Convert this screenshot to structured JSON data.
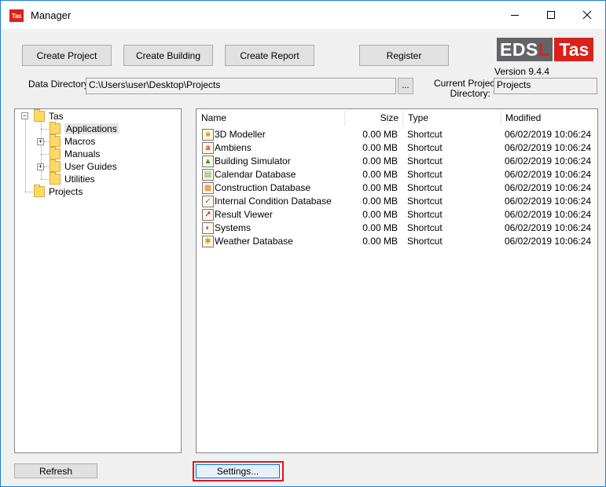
{
  "window": {
    "title": "Manager",
    "icon_text": "Tas",
    "controls": {
      "minimize": "minimize-icon",
      "maximize": "maximize-icon",
      "close": "close-icon"
    }
  },
  "toolbar": {
    "create_project": "Create Project",
    "create_building": "Create Building",
    "create_report": "Create Report",
    "register": "Register"
  },
  "logo": {
    "part1": "EDS",
    "part2": "L",
    "part3": "Tas"
  },
  "version": "Version 9.4.4",
  "data_directory": {
    "label": "Data Directory:",
    "value": "C:\\Users\\user\\Desktop\\Projects",
    "browse_label": "..."
  },
  "current_project": {
    "label_line1": "Current Project",
    "label_line2": "Directory:",
    "value": "Projects"
  },
  "tree": {
    "root": "Tas",
    "children": [
      "Applications",
      "Macros",
      "Manuals",
      "User Guides",
      "Utilities"
    ],
    "projects": "Projects",
    "selected": "Applications"
  },
  "list": {
    "columns": [
      "Name",
      "Size",
      "Type",
      "Modified"
    ],
    "rows": [
      {
        "name": "3D Modeller",
        "size": "0.00 MB",
        "type": "Shortcut",
        "modified": "06/02/2019 10:06:24",
        "icon": "3d-modeller-icon",
        "color": "#f2a20c"
      },
      {
        "name": "Ambiens",
        "size": "0.00 MB",
        "type": "Shortcut",
        "modified": "06/02/2019 10:06:24",
        "icon": "ambiens-icon",
        "color": "#d8221b"
      },
      {
        "name": "Building Simulator",
        "size": "0.00 MB",
        "type": "Shortcut",
        "modified": "06/02/2019 10:06:24",
        "icon": "building-simulator-icon",
        "color": "#1fa12e"
      },
      {
        "name": "Calendar Database",
        "size": "0.00 MB",
        "type": "Shortcut",
        "modified": "06/02/2019 10:06:24",
        "icon": "calendar-database-icon",
        "color": "#5aa532"
      },
      {
        "name": "Construction Database",
        "size": "0.00 MB",
        "type": "Shortcut",
        "modified": "06/02/2019 10:06:24",
        "icon": "construction-database-icon",
        "color": "#e07b1a"
      },
      {
        "name": "Internal Condition Database",
        "size": "0.00 MB",
        "type": "Shortcut",
        "modified": "06/02/2019 10:06:24",
        "icon": "internal-condition-database-icon",
        "color": "#3b6fc8"
      },
      {
        "name": "Result Viewer",
        "size": "0.00 MB",
        "type": "Shortcut",
        "modified": "06/02/2019 10:06:24",
        "icon": "result-viewer-icon",
        "color": "#d8221b"
      },
      {
        "name": "Systems",
        "size": "0.00 MB",
        "type": "Shortcut",
        "modified": "06/02/2019 10:06:24",
        "icon": "systems-icon",
        "color": "#2a6bd1"
      },
      {
        "name": "Weather Database",
        "size": "0.00 MB",
        "type": "Shortcut",
        "modified": "06/02/2019 10:06:24",
        "icon": "weather-database-icon",
        "color": "#e0921a"
      }
    ]
  },
  "footer": {
    "refresh": "Refresh",
    "settings": "Settings..."
  },
  "colors": {
    "highlight_box": "#e4131b",
    "brand_red": "#d8221b",
    "brand_gray": "#646466"
  }
}
